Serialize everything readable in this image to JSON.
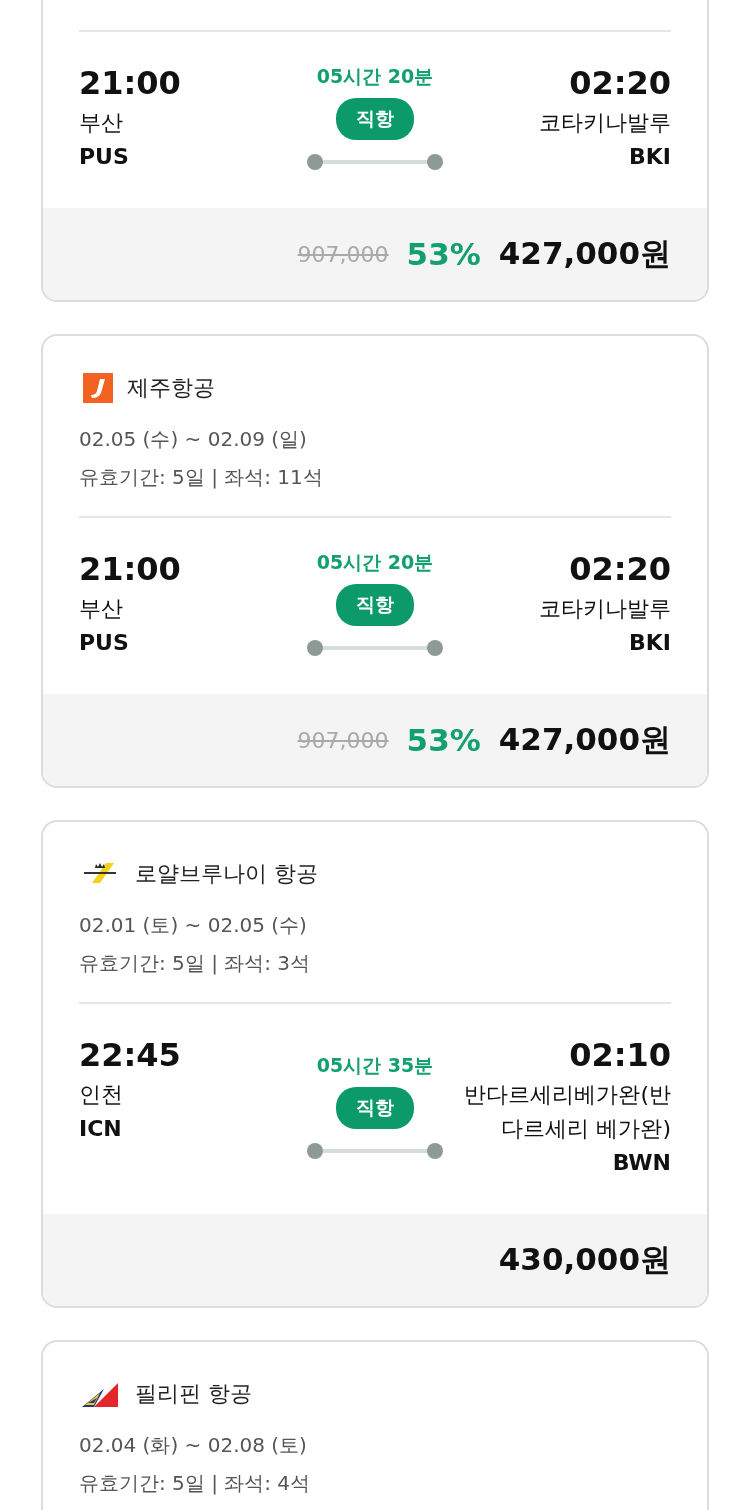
{
  "flights": [
    {
      "departure": {
        "time": "21:00",
        "city": "부산",
        "code": "PUS"
      },
      "duration": "05시간 20분",
      "badge": "직항",
      "arrival": {
        "time": "02:20",
        "city": "코타키나발루",
        "code": "BKI"
      },
      "price": {
        "original": "907,000",
        "discount": "53%",
        "final": "427,000원"
      }
    },
    {
      "airline": {
        "kind": "jeju",
        "name": "제주항공"
      },
      "dates": "02.05 (수) ~ 02.09 (일)",
      "validity": "유효기간: 5일 | 좌석: 11석",
      "departure": {
        "time": "21:00",
        "city": "부산",
        "code": "PUS"
      },
      "duration": "05시간 20분",
      "badge": "직항",
      "arrival": {
        "time": "02:20",
        "city": "코타키나발루",
        "code": "BKI"
      },
      "price": {
        "original": "907,000",
        "discount": "53%",
        "final": "427,000원"
      }
    },
    {
      "airline": {
        "kind": "royal_brunei",
        "name": "로얄브루나이 항공"
      },
      "dates": "02.01 (토) ~ 02.05 (수)",
      "validity": "유효기간: 5일 | 좌석: 3석",
      "departure": {
        "time": "22:45",
        "city": "인천",
        "code": "ICN"
      },
      "duration": "05시간 35분",
      "badge": "직항",
      "arrival": {
        "time": "02:10",
        "city": "반다르세리베가완(반다르세리 베가완)",
        "code": "BWN"
      },
      "price": {
        "final": "430,000원"
      }
    },
    {
      "airline": {
        "kind": "pal",
        "name": "필리핀 항공"
      },
      "dates": "02.04 (화) ~ 02.08 (토)",
      "validity": "유효기간: 5일 | 좌석: 4석"
    }
  ]
}
